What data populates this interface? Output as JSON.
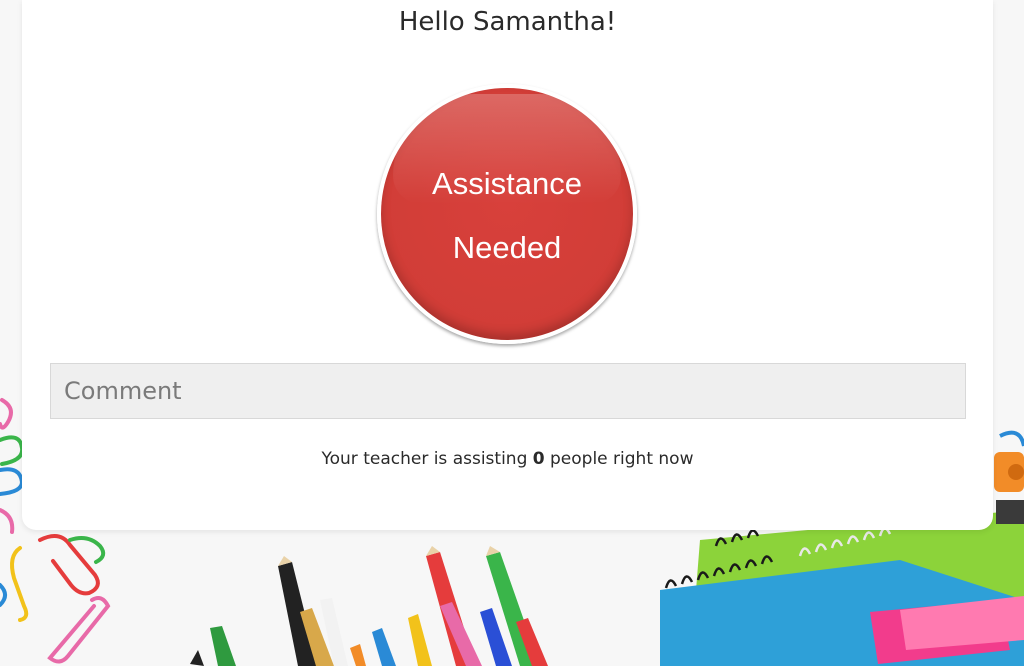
{
  "greeting": "Hello Samantha!",
  "assist_button": {
    "line1": "Assistance",
    "line2": "Needed",
    "color": "#d13d37"
  },
  "comment": {
    "placeholder": "Comment",
    "value": ""
  },
  "status": {
    "prefix": "Your teacher is assisting",
    "count": "0",
    "suffix": "people right now"
  }
}
